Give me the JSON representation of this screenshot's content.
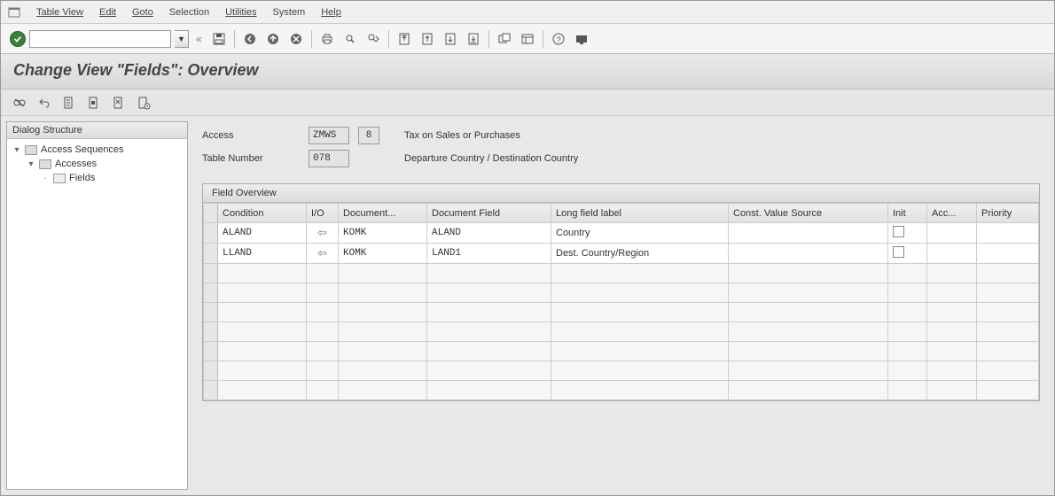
{
  "menu": {
    "items": [
      "Table View",
      "Edit",
      "Goto",
      "Selection",
      "Utilities",
      "System",
      "Help"
    ]
  },
  "toolbar": {
    "cmd_value": "",
    "icons": [
      "save-icon",
      "back-icon",
      "exit-icon",
      "cancel-icon",
      "print-icon",
      "find-icon",
      "find-next-icon",
      "first-page-icon",
      "prev-page-icon",
      "next-page-icon",
      "last-page-icon",
      "new-session-icon",
      "layout-icon",
      "help-icon",
      "customize-icon"
    ]
  },
  "title": "Change View \"Fields\": Overview",
  "app_toolbar": {
    "icons": [
      "toggle-icon",
      "undo-icon",
      "select-all-icon",
      "select-block-icon",
      "deselect-icon",
      "table-settings-icon"
    ]
  },
  "tree": {
    "header": "Dialog Structure",
    "nodes": [
      {
        "level": 1,
        "label": "Access Sequences",
        "expanded": true,
        "selected": false
      },
      {
        "level": 2,
        "label": "Accesses",
        "expanded": true,
        "selected": false
      },
      {
        "level": 3,
        "label": "Fields",
        "expanded": false,
        "selected": true
      }
    ]
  },
  "form": {
    "access_label": "Access",
    "access_code": "ZMWS",
    "access_step": "8",
    "access_desc": "Tax on Sales or Purchases",
    "table_label": "Table Number",
    "table_number": "078",
    "table_desc": "Departure Country / Destination Country"
  },
  "grid": {
    "title": "Field Overview",
    "columns": [
      "Condition",
      "I/O",
      "Document...",
      "Document Field",
      "Long field label",
      "Const. Value Source",
      "Init",
      "Acc...",
      "Priority"
    ],
    "rows": [
      {
        "condition": "ALAND",
        "io": "left",
        "doc_struct": "KOMK",
        "doc_field": "ALAND",
        "long_label": "Country",
        "const": "",
        "init": false,
        "acc": "",
        "priority": ""
      },
      {
        "condition": "LLAND",
        "io": "left",
        "doc_struct": "KOMK",
        "doc_field": "LAND1",
        "long_label": "Dest. Country/Region",
        "const": "",
        "init": false,
        "acc": "",
        "priority": ""
      }
    ],
    "empty_rows": 7
  }
}
